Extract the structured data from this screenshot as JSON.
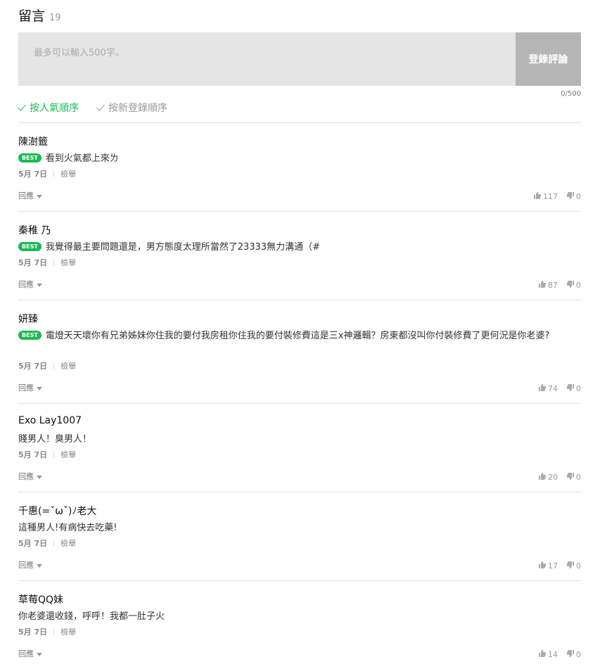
{
  "header": {
    "title": "留言",
    "count": "19"
  },
  "composer": {
    "placeholder": "最多可以輸入500字。",
    "submit_label": "登錄評論",
    "char_count": "0/500"
  },
  "sort": {
    "popular_label": "按人氣順序",
    "newest_label": "按新登錄順序"
  },
  "labels": {
    "best": "BEST",
    "report": "檢舉",
    "reply": "回應"
  },
  "colors": {
    "accent": "#1db954",
    "composer_bg": "#e5e5e5",
    "submit_bg": "#b5b5b5"
  },
  "comments": [
    {
      "author": "陳澍籤",
      "best": true,
      "text": "看到火氣都上來ㄌ",
      "date": "5月 7日",
      "likes": "117",
      "dislikes": "0"
    },
    {
      "author": "秦稚 乃",
      "best": true,
      "text": "我覺得最主要問題還是，男方態度太理所當然了23333無力溝通（#",
      "date": "5月 7日",
      "likes": "87",
      "dislikes": "0"
    },
    {
      "author": "妍臻",
      "best": true,
      "text": "電燈天天壞你有兄弟姊妹你住我的要付我房租你住我的要付裝修費這是三x神邏輯？房東都沒叫你付裝修費了更何況是你老婆?",
      "date": "5月 7日",
      "likes": "74",
      "dislikes": "0"
    },
    {
      "author": "Exo Lay1007",
      "best": false,
      "text": "賤男人！臭男人！",
      "date": "5月 7日",
      "likes": "20",
      "dislikes": "0"
    },
    {
      "author": "千惠(=ˇωˇ)ﾉ老大",
      "best": false,
      "text": "這種男人!有病快去吃藥!",
      "date": "5月 7日",
      "likes": "17",
      "dislikes": "0"
    },
    {
      "author": "草莓QQ妹",
      "best": false,
      "text": "你老婆還收錢，呼呼！我都一肚子火",
      "date": "5月 7日",
      "likes": "14",
      "dislikes": "0"
    }
  ]
}
